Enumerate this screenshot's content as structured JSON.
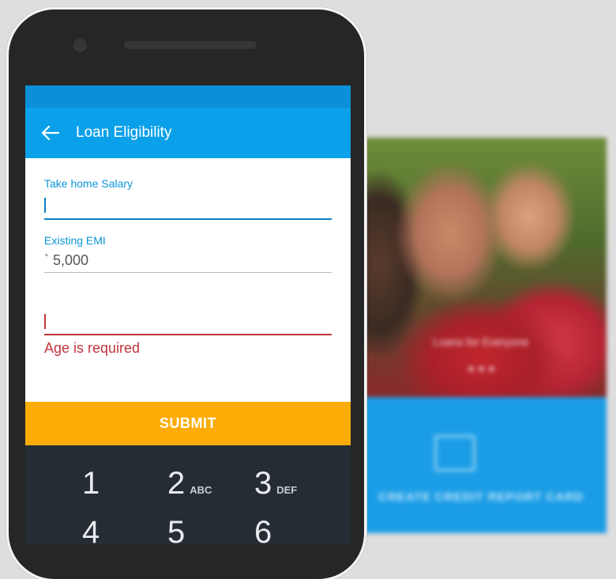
{
  "background_screen": {
    "caption": "Loans for Everyone",
    "cta": "CREATE CREDIT REPORT CARD"
  },
  "app": {
    "title": "Loan Eligibility",
    "back_icon": "arrow-left-icon"
  },
  "form": {
    "salary": {
      "label": "Take home Salary",
      "value": ""
    },
    "emi": {
      "label": "Existing EMI",
      "value": "` 5,000"
    },
    "age": {
      "label": "",
      "value": "",
      "error": "Age is required"
    }
  },
  "submit_label": "SUBMIT",
  "keypad": {
    "keys": [
      {
        "num": "1",
        "letters": ""
      },
      {
        "num": "2",
        "letters": "ABC"
      },
      {
        "num": "3",
        "letters": "DEF"
      },
      {
        "num": "4",
        "letters": ""
      },
      {
        "num": "5",
        "letters": ""
      },
      {
        "num": "6",
        "letters": ""
      }
    ]
  },
  "colors": {
    "accent": "#0ba0ea",
    "status_bar": "#0a8fd8",
    "submit": "#fbac06",
    "error": "#c0353b",
    "keypad": "#252c33"
  }
}
